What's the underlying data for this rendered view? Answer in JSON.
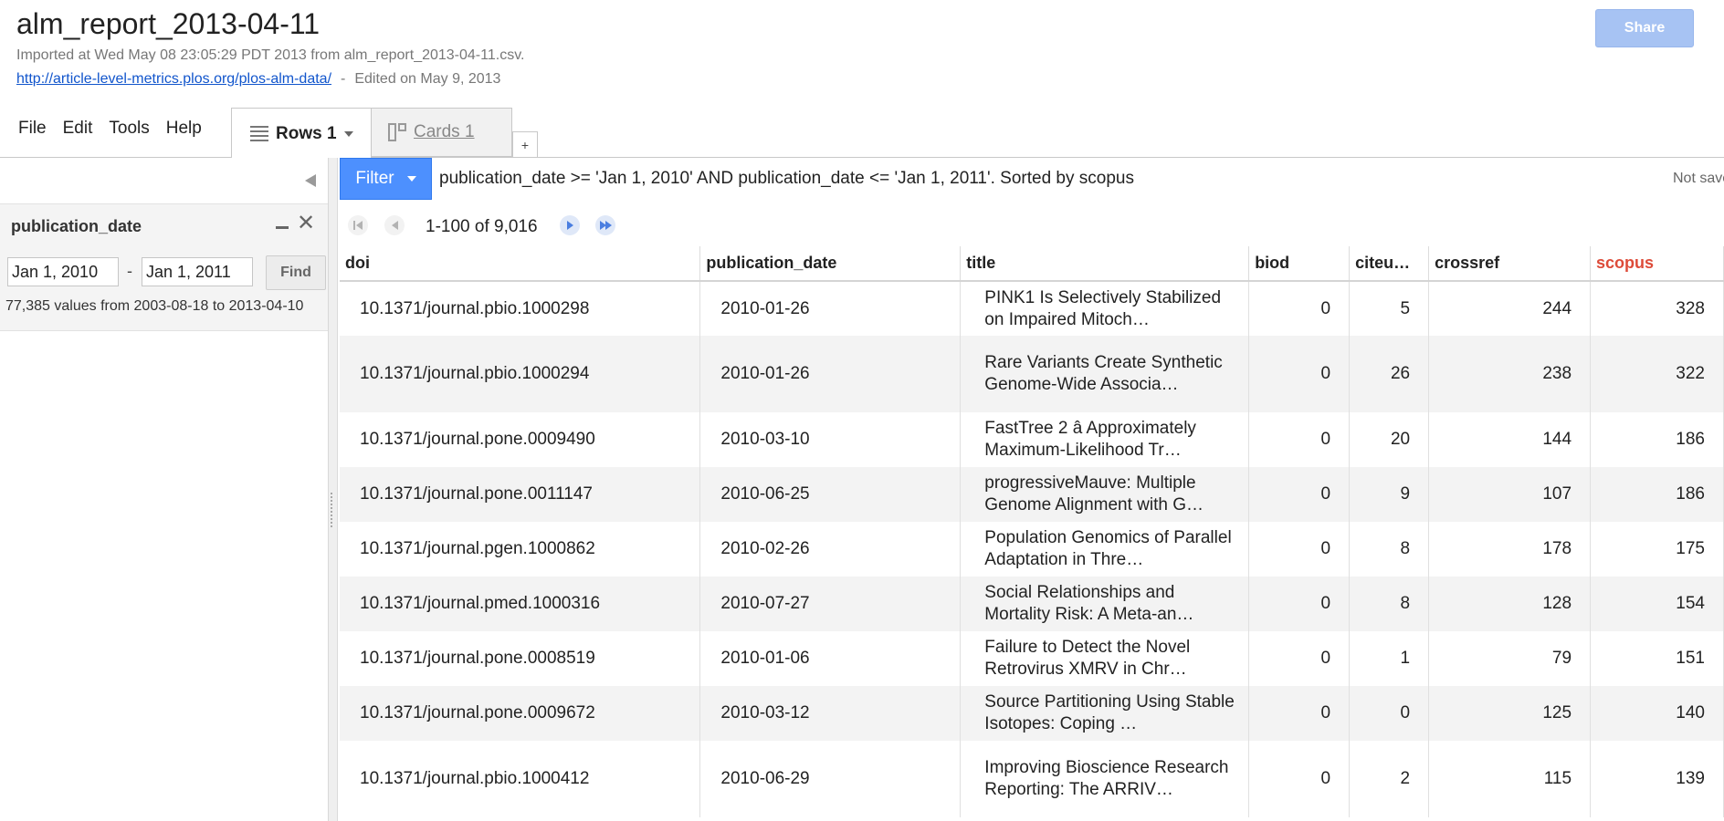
{
  "header": {
    "title": "alm_report_2013-04-11",
    "import_line": "Imported at Wed May 08 23:05:29 PDT 2013 from alm_report_2013-04-11.csv.",
    "source_link": "http://article-level-metrics.plos.org/plos-alm-data/",
    "separator": "-",
    "edited": "Edited on May 9, 2013",
    "share_label": "Share"
  },
  "menu": [
    "File",
    "Edit",
    "Tools",
    "Help"
  ],
  "tabs": {
    "rows_label": "Rows 1",
    "cards_label": "Cards 1",
    "add_label": "+"
  },
  "filter_panel": {
    "column": "publication_date",
    "from": "Jan 1, 2010",
    "to": "Jan 1, 2011",
    "dash": "-",
    "find_label": "Find",
    "range_text": "77,385 values from 2003-08-18 to 2013-04-10"
  },
  "filter_bar": {
    "button_label": "Filter",
    "expression": "publication_date >= 'Jan 1, 2010' AND publication_date <= 'Jan 1, 2011'. Sorted by scopus",
    "save_status": "Not saved"
  },
  "pager": {
    "text": "1-100 of 9,016"
  },
  "table": {
    "columns": [
      "doi",
      "publication_date",
      "title",
      "biod",
      "citeu…",
      "crossref",
      "scopus"
    ],
    "sorted_column": "scopus",
    "rows": [
      {
        "doi": "10.1371/journal.pbio.1000298",
        "date": "2010-01-26",
        "title": "PINK1 Is Selectively Stabilized on Impaired Mitoch…",
        "biod": "0",
        "citeu": "5",
        "crossref": "244",
        "scopus": "328"
      },
      {
        "doi": "10.1371/journal.pbio.1000294",
        "date": "2010-01-26",
        "title": "Rare Variants Create Synthetic Genome-Wide Associa…",
        "biod": "0",
        "citeu": "26",
        "crossref": "238",
        "scopus": "322"
      },
      {
        "doi": "10.1371/journal.pone.0009490",
        "date": "2010-03-10",
        "title": "FastTree 2 â Approximately Maximum-Likelihood Tr…",
        "biod": "0",
        "citeu": "20",
        "crossref": "144",
        "scopus": "186"
      },
      {
        "doi": "10.1371/journal.pone.0011147",
        "date": "2010-06-25",
        "title": "progressiveMauve: Multiple Genome Alignment with G…",
        "biod": "0",
        "citeu": "9",
        "crossref": "107",
        "scopus": "186"
      },
      {
        "doi": "10.1371/journal.pgen.1000862",
        "date": "2010-02-26",
        "title": "Population Genomics of Parallel Adaptation in Thre…",
        "biod": "0",
        "citeu": "8",
        "crossref": "178",
        "scopus": "175"
      },
      {
        "doi": "10.1371/journal.pmed.1000316",
        "date": "2010-07-27",
        "title": "Social Relationships and Mortality Risk: A Meta-an…",
        "biod": "0",
        "citeu": "8",
        "crossref": "128",
        "scopus": "154"
      },
      {
        "doi": "10.1371/journal.pone.0008519",
        "date": "2010-01-06",
        "title": "Failure to Detect the Novel Retrovirus XMRV in Chr…",
        "biod": "0",
        "citeu": "1",
        "crossref": "79",
        "scopus": "151"
      },
      {
        "doi": "10.1371/journal.pone.0009672",
        "date": "2010-03-12",
        "title": "Source Partitioning Using Stable Isotopes: Coping …",
        "biod": "0",
        "citeu": "0",
        "crossref": "125",
        "scopus": "140"
      },
      {
        "doi": "10.1371/journal.pbio.1000412",
        "date": "2010-06-29",
        "title": "Improving Bioscience Research Reporting: The ARRIV…",
        "biod": "0",
        "citeu": "2",
        "crossref": "115",
        "scopus": "139"
      }
    ]
  },
  "colors": {
    "accent": "#4d90fe",
    "share_disabled": "#a7c3f3",
    "sorted_header": "#dd4b39",
    "link": "#1155cc"
  }
}
